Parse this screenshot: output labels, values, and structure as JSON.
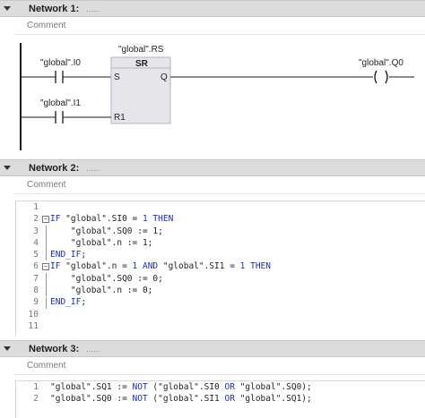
{
  "networks": [
    {
      "title": "Network 1:",
      "dots": "......",
      "comment": "Comment"
    },
    {
      "title": "Network 2:",
      "dots": "......",
      "comment": "Comment"
    },
    {
      "title": "Network 3:",
      "dots": "......",
      "comment": "Comment"
    }
  ],
  "ladder": {
    "block_instance": "\"global\".RS",
    "block_type": "SR",
    "pin_s": "S",
    "pin_r1": "R1",
    "pin_q": "Q",
    "contact1_label": "\"global\".I0",
    "contact2_label": "\"global\".I1",
    "coil_label": "\"global\".Q0"
  },
  "scl2": [
    {
      "n": "1",
      "fold": "",
      "parts": []
    },
    {
      "n": "2",
      "fold": "box",
      "parts": [
        [
          "kw",
          "IF "
        ],
        [
          "txt",
          "\"global\".SI0 = "
        ],
        [
          "kw",
          "1 THEN"
        ]
      ]
    },
    {
      "n": "3",
      "fold": "line",
      "parts": [
        [
          "txt",
          "    \"global\".SQ0 := 1;"
        ]
      ]
    },
    {
      "n": "4",
      "fold": "line",
      "parts": [
        [
          "txt",
          "    \"global\".n := 1;"
        ]
      ]
    },
    {
      "n": "5",
      "fold": "line",
      "parts": [
        [
          "kw",
          "END_IF"
        ],
        [
          "txt",
          ";"
        ]
      ]
    },
    {
      "n": "6",
      "fold": "box",
      "parts": [
        [
          "kw",
          "IF "
        ],
        [
          "txt",
          "\"global\".n = "
        ],
        [
          "kw",
          "1 AND "
        ],
        [
          "txt",
          "\"global\".SI1 = "
        ],
        [
          "kw",
          "1 THEN"
        ]
      ]
    },
    {
      "n": "7",
      "fold": "line",
      "parts": [
        [
          "txt",
          "    \"global\".SQ0 := 0;"
        ]
      ]
    },
    {
      "n": "8",
      "fold": "line",
      "parts": [
        [
          "txt",
          "    \"global\".n := 0;"
        ]
      ]
    },
    {
      "n": "9",
      "fold": "line",
      "parts": [
        [
          "kw",
          "END_IF"
        ],
        [
          "txt",
          ";"
        ]
      ]
    },
    {
      "n": "10",
      "fold": "",
      "parts": []
    },
    {
      "n": "11",
      "fold": "",
      "parts": []
    }
  ],
  "scl3": [
    {
      "n": "1",
      "fold": "",
      "parts": [
        [
          "txt",
          "\"global\".SQ1 := "
        ],
        [
          "kw",
          "NOT "
        ],
        [
          "txt",
          "(\"global\".SI0 "
        ],
        [
          "kw",
          "OR "
        ],
        [
          "txt",
          "\"global\".SQ0);"
        ]
      ]
    },
    {
      "n": "2",
      "fold": "",
      "parts": [
        [
          "txt",
          "\"global\".SQ0 := "
        ],
        [
          "kw",
          "NOT "
        ],
        [
          "txt",
          "(\"global\".SI1 "
        ],
        [
          "kw",
          "OR "
        ],
        [
          "txt",
          "\"global\".SQ1);"
        ]
      ]
    }
  ]
}
